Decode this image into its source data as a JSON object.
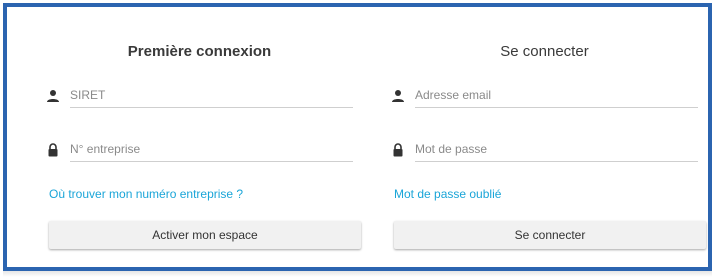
{
  "first_login": {
    "title": "Première connexion",
    "siret": {
      "placeholder": "SIRET",
      "value": "",
      "icon": "person-icon"
    },
    "company_number": {
      "placeholder": "N° entreprise",
      "value": "",
      "icon": "lock-icon"
    },
    "help_link": "Où trouver mon numéro entreprise ?",
    "activate_button": "Activer mon espace"
  },
  "sign_in": {
    "title": "Se connecter",
    "email": {
      "placeholder": "Adresse email",
      "value": "",
      "icon": "person-icon"
    },
    "password": {
      "placeholder": "Mot de passe",
      "value": "",
      "icon": "lock-icon"
    },
    "forgot_link": "Mot de passe oublié",
    "connect_button": "Se connecter"
  },
  "colors": {
    "frame_border": "#2b64b0",
    "link": "#1aa5d8",
    "button_bg": "#f1f1f1"
  }
}
